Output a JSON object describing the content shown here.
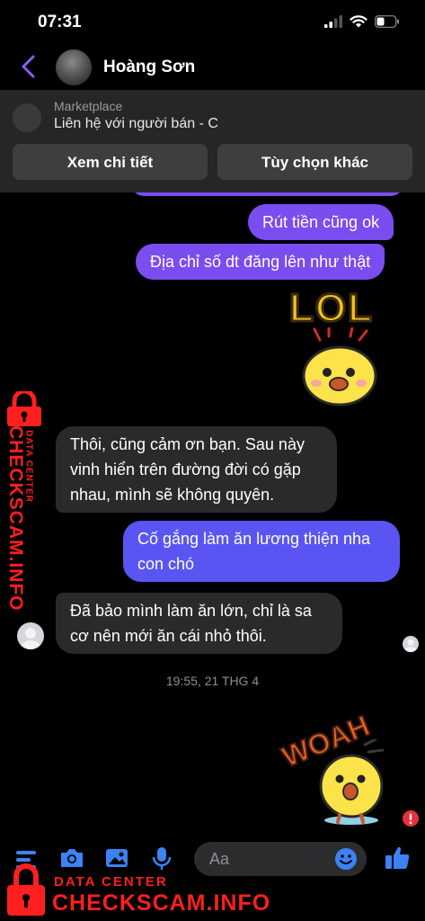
{
  "status": {
    "time": "07:31"
  },
  "header": {
    "name": "Hoàng Sơn"
  },
  "marketplace": {
    "title": "Marketplace",
    "subtitle": "Liên hệ với người bán - C",
    "btn_details": "Xem chi tiết",
    "btn_options": "Tùy chọn khác"
  },
  "messages": {
    "m1": "Rút tiền cũng ok",
    "m2": "Địa chỉ số dt đăng lên như thật",
    "m3_l1": "Thôi, cũng cảm ơn bạn. Sau này",
    "m3_l2": "vinh hiển trên đường đời có gặp",
    "m3_l3": "nhau, mình sẽ không quyên.",
    "m4_l1": "Cố gắng làm ăn lương thiện nha",
    "m4_l2": "con chó",
    "m5_l1": "Đã bảo mình làm ăn lớn, chỉ là sa",
    "m5_l2": "cơ nên mới ăn cái nhỏ thôi."
  },
  "timestamp": "19:55, 21 THG 4",
  "stickers": {
    "lol": "LOL",
    "woah": "WOAH"
  },
  "composer": {
    "placeholder": "Aa"
  },
  "watermark": {
    "top": "DATA CENTER",
    "bottom": "CHECKSCAM.INFO"
  },
  "colors": {
    "outgoing": "#7a4df0",
    "incoming": "#2a2a2d",
    "accent": "#3c82f6",
    "watermark": "#ff1f1f"
  }
}
